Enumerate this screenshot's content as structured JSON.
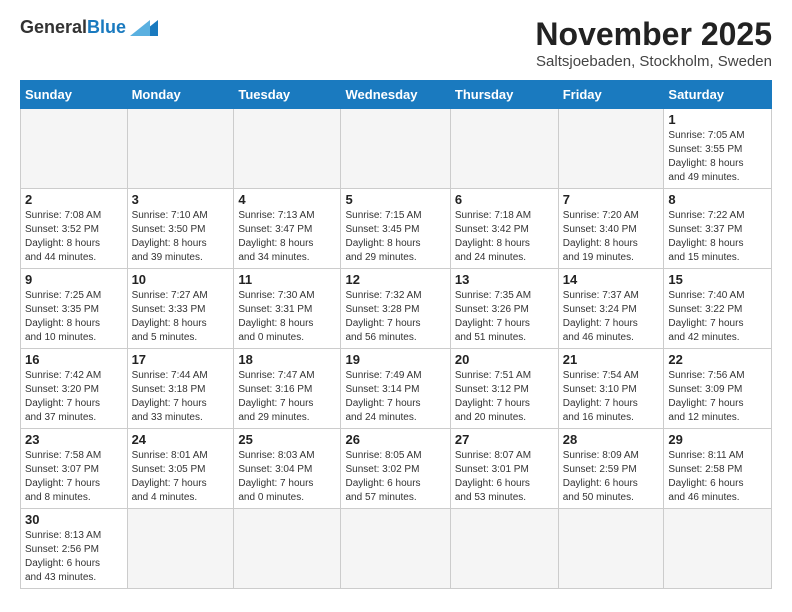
{
  "header": {
    "logo_general": "General",
    "logo_blue": "Blue",
    "title": "November 2025",
    "location": "Saltsjoebaden, Stockholm, Sweden"
  },
  "days_of_week": [
    "Sunday",
    "Monday",
    "Tuesday",
    "Wednesday",
    "Thursday",
    "Friday",
    "Saturday"
  ],
  "weeks": [
    [
      {
        "day": "",
        "info": ""
      },
      {
        "day": "",
        "info": ""
      },
      {
        "day": "",
        "info": ""
      },
      {
        "day": "",
        "info": ""
      },
      {
        "day": "",
        "info": ""
      },
      {
        "day": "",
        "info": ""
      },
      {
        "day": "1",
        "info": "Sunrise: 7:05 AM\nSunset: 3:55 PM\nDaylight: 8 hours\nand 49 minutes."
      }
    ],
    [
      {
        "day": "2",
        "info": "Sunrise: 7:08 AM\nSunset: 3:52 PM\nDaylight: 8 hours\nand 44 minutes."
      },
      {
        "day": "3",
        "info": "Sunrise: 7:10 AM\nSunset: 3:50 PM\nDaylight: 8 hours\nand 39 minutes."
      },
      {
        "day": "4",
        "info": "Sunrise: 7:13 AM\nSunset: 3:47 PM\nDaylight: 8 hours\nand 34 minutes."
      },
      {
        "day": "5",
        "info": "Sunrise: 7:15 AM\nSunset: 3:45 PM\nDaylight: 8 hours\nand 29 minutes."
      },
      {
        "day": "6",
        "info": "Sunrise: 7:18 AM\nSunset: 3:42 PM\nDaylight: 8 hours\nand 24 minutes."
      },
      {
        "day": "7",
        "info": "Sunrise: 7:20 AM\nSunset: 3:40 PM\nDaylight: 8 hours\nand 19 minutes."
      },
      {
        "day": "8",
        "info": "Sunrise: 7:22 AM\nSunset: 3:37 PM\nDaylight: 8 hours\nand 15 minutes."
      }
    ],
    [
      {
        "day": "9",
        "info": "Sunrise: 7:25 AM\nSunset: 3:35 PM\nDaylight: 8 hours\nand 10 minutes."
      },
      {
        "day": "10",
        "info": "Sunrise: 7:27 AM\nSunset: 3:33 PM\nDaylight: 8 hours\nand 5 minutes."
      },
      {
        "day": "11",
        "info": "Sunrise: 7:30 AM\nSunset: 3:31 PM\nDaylight: 8 hours\nand 0 minutes."
      },
      {
        "day": "12",
        "info": "Sunrise: 7:32 AM\nSunset: 3:28 PM\nDaylight: 7 hours\nand 56 minutes."
      },
      {
        "day": "13",
        "info": "Sunrise: 7:35 AM\nSunset: 3:26 PM\nDaylight: 7 hours\nand 51 minutes."
      },
      {
        "day": "14",
        "info": "Sunrise: 7:37 AM\nSunset: 3:24 PM\nDaylight: 7 hours\nand 46 minutes."
      },
      {
        "day": "15",
        "info": "Sunrise: 7:40 AM\nSunset: 3:22 PM\nDaylight: 7 hours\nand 42 minutes."
      }
    ],
    [
      {
        "day": "16",
        "info": "Sunrise: 7:42 AM\nSunset: 3:20 PM\nDaylight: 7 hours\nand 37 minutes."
      },
      {
        "day": "17",
        "info": "Sunrise: 7:44 AM\nSunset: 3:18 PM\nDaylight: 7 hours\nand 33 minutes."
      },
      {
        "day": "18",
        "info": "Sunrise: 7:47 AM\nSunset: 3:16 PM\nDaylight: 7 hours\nand 29 minutes."
      },
      {
        "day": "19",
        "info": "Sunrise: 7:49 AM\nSunset: 3:14 PM\nDaylight: 7 hours\nand 24 minutes."
      },
      {
        "day": "20",
        "info": "Sunrise: 7:51 AM\nSunset: 3:12 PM\nDaylight: 7 hours\nand 20 minutes."
      },
      {
        "day": "21",
        "info": "Sunrise: 7:54 AM\nSunset: 3:10 PM\nDaylight: 7 hours\nand 16 minutes."
      },
      {
        "day": "22",
        "info": "Sunrise: 7:56 AM\nSunset: 3:09 PM\nDaylight: 7 hours\nand 12 minutes."
      }
    ],
    [
      {
        "day": "23",
        "info": "Sunrise: 7:58 AM\nSunset: 3:07 PM\nDaylight: 7 hours\nand 8 minutes."
      },
      {
        "day": "24",
        "info": "Sunrise: 8:01 AM\nSunset: 3:05 PM\nDaylight: 7 hours\nand 4 minutes."
      },
      {
        "day": "25",
        "info": "Sunrise: 8:03 AM\nSunset: 3:04 PM\nDaylight: 7 hours\nand 0 minutes."
      },
      {
        "day": "26",
        "info": "Sunrise: 8:05 AM\nSunset: 3:02 PM\nDaylight: 6 hours\nand 57 minutes."
      },
      {
        "day": "27",
        "info": "Sunrise: 8:07 AM\nSunset: 3:01 PM\nDaylight: 6 hours\nand 53 minutes."
      },
      {
        "day": "28",
        "info": "Sunrise: 8:09 AM\nSunset: 2:59 PM\nDaylight: 6 hours\nand 50 minutes."
      },
      {
        "day": "29",
        "info": "Sunrise: 8:11 AM\nSunset: 2:58 PM\nDaylight: 6 hours\nand 46 minutes."
      }
    ],
    [
      {
        "day": "30",
        "info": "Sunrise: 8:13 AM\nSunset: 2:56 PM\nDaylight: 6 hours\nand 43 minutes."
      },
      {
        "day": "",
        "info": ""
      },
      {
        "day": "",
        "info": ""
      },
      {
        "day": "",
        "info": ""
      },
      {
        "day": "",
        "info": ""
      },
      {
        "day": "",
        "info": ""
      },
      {
        "day": "",
        "info": ""
      }
    ]
  ]
}
